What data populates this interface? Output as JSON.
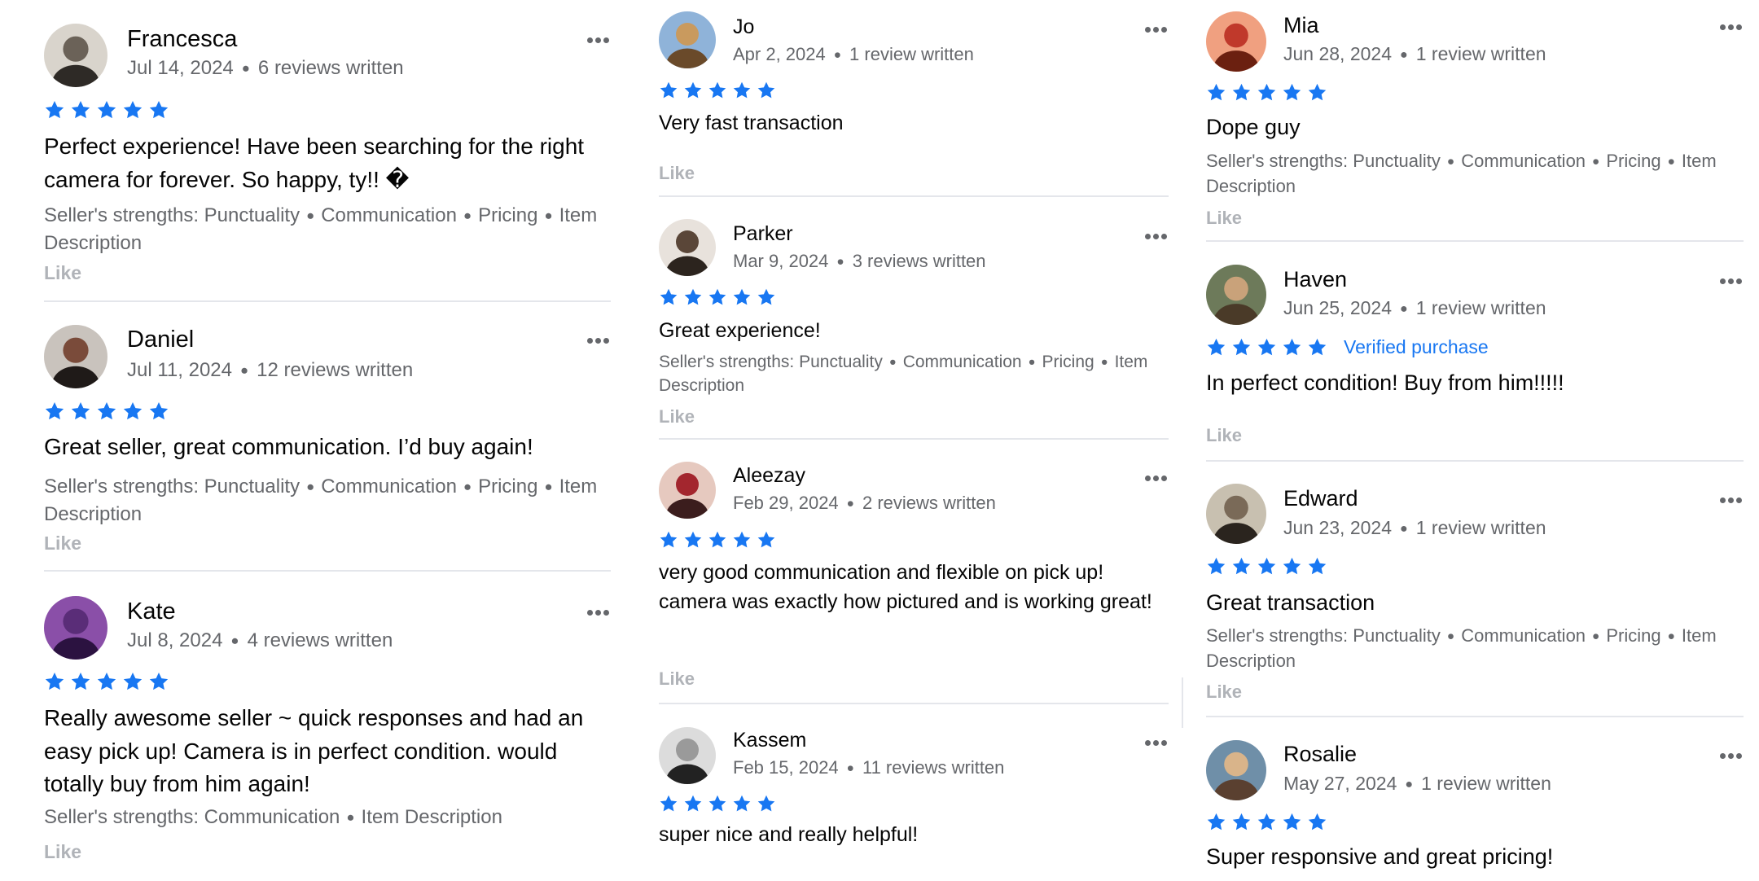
{
  "like_label": "Like",
  "strengths_prefix": "Seller's strengths: ",
  "more_icon": "more-horizontal-icon",
  "star_color": "#1877f2",
  "reviews": [
    {
      "name": "Francesca",
      "date": "Jul 14, 2024",
      "count": "6 reviews written",
      "text": "Perfect experience! Have been searching for the right camera for forever. So happy, ty!! �",
      "strengths": [
        "Punctuality",
        "Communication",
        "Pricing",
        "Item Description"
      ]
    },
    {
      "name": "Daniel",
      "date": "Jul 11, 2024",
      "count": "12 reviews written",
      "text": "Great seller, great communication. I’d buy again!",
      "strengths": [
        "Punctuality",
        "Communication",
        "Pricing",
        "Item Description"
      ]
    },
    {
      "name": "Kate",
      "date": "Jul 8, 2024",
      "count": "4 reviews written",
      "text": "Really awesome seller ~ quick responses and had an easy pick up! Camera is in perfect condition. would totally buy from him again!",
      "strengths": [
        "Communication",
        "Item Description"
      ]
    },
    {
      "name": "Jo",
      "date": "Apr 2, 2024",
      "count": "1 review written",
      "text": "Very fast transaction",
      "strengths": []
    },
    {
      "name": "Parker",
      "date": "Mar 9, 2024",
      "count": "3 reviews written",
      "text": "Great experience!",
      "strengths": [
        "Punctuality",
        "Communication",
        "Pricing",
        "Item Description"
      ]
    },
    {
      "name": "Aleezay",
      "date": "Feb 29, 2024",
      "count": "2 reviews written",
      "text": "very good communication and flexible on pick up! camera was exactly how pictured and is working great!",
      "strengths": []
    },
    {
      "name": "Kassem",
      "date": "Feb 15, 2024",
      "count": "11 reviews written",
      "text": "super nice and really helpful!",
      "strengths": []
    },
    {
      "name": "Mia",
      "date": "Jun 28, 2024",
      "count": "1 review written",
      "text": "Dope guy",
      "strengths": [
        "Punctuality",
        "Communication",
        "Pricing",
        "Item Description"
      ]
    },
    {
      "name": "Haven",
      "date": "Jun 25, 2024",
      "count": "1 review written",
      "verified": "Verified purchase",
      "text": "In perfect condition! Buy from him!!!!!",
      "strengths": []
    },
    {
      "name": "Edward",
      "date": "Jun 23, 2024",
      "count": "1 review written",
      "text": "Great transaction",
      "strengths": [
        "Punctuality",
        "Communication",
        "Pricing",
        "Item Description"
      ]
    },
    {
      "name": "Rosalie",
      "date": "May 27, 2024",
      "count": "1 review written",
      "text": "Super responsive and great pricing!",
      "strengths": []
    }
  ]
}
